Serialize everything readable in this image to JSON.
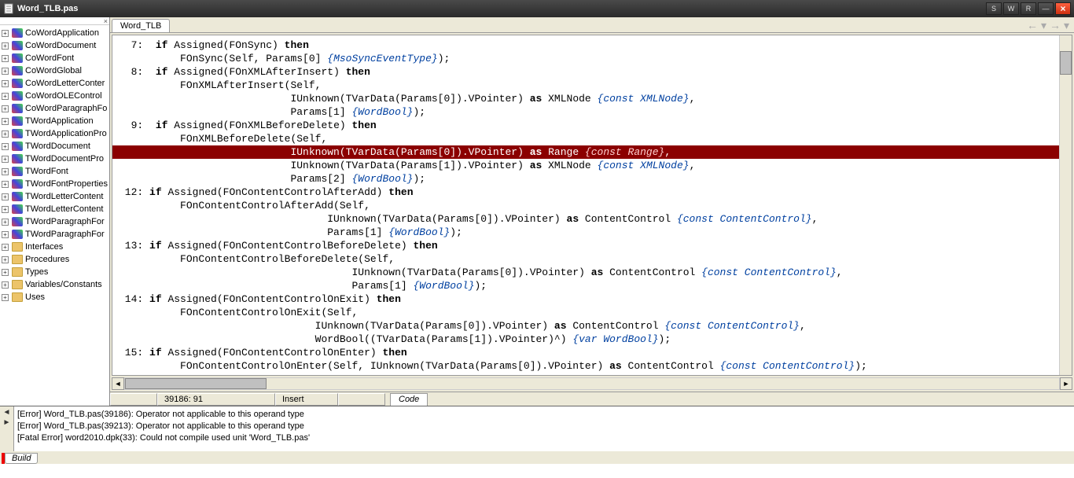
{
  "title": "Word_TLB.pas",
  "win_buttons": {
    "s": "S",
    "w": "W",
    "r": "R",
    "min": "—",
    "close": "×"
  },
  "tree": {
    "class_items": [
      "CoWordApplication",
      "CoWordDocument",
      "CoWordFont",
      "CoWordGlobal",
      "CoWordLetterConter",
      "CoWordOLEControl",
      "CoWordParagraphFo",
      "TWordApplication",
      "TWordApplicationPro",
      "TWordDocument",
      "TWordDocumentPro",
      "TWordFont",
      "TWordFontProperties",
      "TWordLetterContent",
      "TWordLetterContent",
      "TWordParagraphFor",
      "TWordParagraphFor"
    ],
    "folder_items": [
      "Interfaces",
      "Procedures",
      "Types",
      "Variables/Constants",
      "Uses"
    ]
  },
  "editor": {
    "open_tab": "Word_TLB",
    "lines": [
      {
        "n": "7:",
        "code": [
          "  ",
          [
            "kw",
            "if"
          ],
          " Assigned(FOnSync) ",
          [
            "kw",
            "then"
          ]
        ]
      },
      {
        "n": "",
        "code": [
          "      FOnSync(Self, Params[0] ",
          [
            "cmt",
            "{MsoSyncEventType}"
          ],
          ");"
        ]
      },
      {
        "n": "8:",
        "code": [
          "  ",
          [
            "kw",
            "if"
          ],
          " Assigned(FOnXMLAfterInsert) ",
          [
            "kw",
            "then"
          ]
        ]
      },
      {
        "n": "",
        "code": [
          "      FOnXMLAfterInsert(Self,"
        ]
      },
      {
        "n": "",
        "code": [
          "                        IUnknown(TVarData(Params[0]).VPointer) ",
          [
            "kw",
            "as"
          ],
          " XMLNode ",
          [
            "cmt",
            "{const XMLNode}"
          ],
          ","
        ]
      },
      {
        "n": "",
        "code": [
          "                        Params[1] ",
          [
            "cmt",
            "{WordBool}"
          ],
          ");"
        ]
      },
      {
        "n": "9:",
        "code": [
          "  ",
          [
            "kw",
            "if"
          ],
          " Assigned(FOnXMLBeforeDelete) ",
          [
            "kw",
            "then"
          ]
        ]
      },
      {
        "n": "",
        "code": [
          "      FOnXMLBeforeDelete(Self,"
        ]
      },
      {
        "n": "",
        "hl": true,
        "code": [
          "                        IUnknown(TVarData(Params[0]).VPointer) ",
          [
            "kw",
            "as"
          ],
          " Range ",
          [
            "cmt",
            "{const Range}"
          ],
          ","
        ]
      },
      {
        "n": "",
        "code": [
          "                        IUnknown(TVarData(Params[1]).VPointer) ",
          [
            "kw",
            "as"
          ],
          " XMLNode ",
          [
            "cmt",
            "{const XMLNode}"
          ],
          ","
        ]
      },
      {
        "n": "",
        "code": [
          "                        Params[2] ",
          [
            "cmt",
            "{WordBool}"
          ],
          ");"
        ]
      },
      {
        "n": "12:",
        "code": [
          " ",
          [
            "kw",
            "if"
          ],
          " Assigned(FOnContentControlAfterAdd) ",
          [
            "kw",
            "then"
          ]
        ]
      },
      {
        "n": "",
        "code": [
          "      FOnContentControlAfterAdd(Self,"
        ]
      },
      {
        "n": "",
        "code": [
          "                              IUnknown(TVarData(Params[0]).VPointer) ",
          [
            "kw",
            "as"
          ],
          " ContentControl ",
          [
            "cmt",
            "{const ContentControl}"
          ],
          ","
        ]
      },
      {
        "n": "",
        "code": [
          "                              Params[1] ",
          [
            "cmt",
            "{WordBool}"
          ],
          ");"
        ]
      },
      {
        "n": "13:",
        "code": [
          " ",
          [
            "kw",
            "if"
          ],
          " Assigned(FOnContentControlBeforeDelete) ",
          [
            "kw",
            "then"
          ]
        ]
      },
      {
        "n": "",
        "code": [
          "      FOnContentControlBeforeDelete(Self,"
        ]
      },
      {
        "n": "",
        "code": [
          "                                  IUnknown(TVarData(Params[0]).VPointer) ",
          [
            "kw",
            "as"
          ],
          " ContentControl ",
          [
            "cmt",
            "{const ContentControl}"
          ],
          ","
        ]
      },
      {
        "n": "",
        "code": [
          "                                  Params[1] ",
          [
            "cmt",
            "{WordBool}"
          ],
          ");"
        ]
      },
      {
        "n": "14:",
        "code": [
          " ",
          [
            "kw",
            "if"
          ],
          " Assigned(FOnContentControlOnExit) ",
          [
            "kw",
            "then"
          ]
        ]
      },
      {
        "n": "",
        "code": [
          "      FOnContentControlOnExit(Self,"
        ]
      },
      {
        "n": "",
        "code": [
          "                            IUnknown(TVarData(Params[0]).VPointer) ",
          [
            "kw",
            "as"
          ],
          " ContentControl ",
          [
            "cmt",
            "{const ContentControl}"
          ],
          ","
        ]
      },
      {
        "n": "",
        "code": [
          "                            WordBool((TVarData(Params[1]).VPointer)^) ",
          [
            "cmt",
            "{var WordBool}"
          ],
          ");"
        ]
      },
      {
        "n": "15:",
        "code": [
          " ",
          [
            "kw",
            "if"
          ],
          " Assigned(FOnContentControlOnEnter) ",
          [
            "kw",
            "then"
          ]
        ]
      },
      {
        "n": "",
        "code": [
          "      FOnContentControlOnEnter(Self, IUnknown(TVarData(Params[0]).VPointer) ",
          [
            "kw",
            "as"
          ],
          " ContentControl ",
          [
            "cmt",
            "{const ContentControl}"
          ],
          ");"
        ]
      }
    ]
  },
  "status": {
    "pos": "39186: 91",
    "mode": "Insert",
    "view_tab": "Code"
  },
  "messages": [
    "[Error] Word_TLB.pas(39186): Operator not applicable to this operand type",
    "[Error] Word_TLB.pas(39213): Operator not applicable to this operand type",
    "[Fatal Error] word2010.dpk(33): Could not compile used unit 'Word_TLB.pas'"
  ],
  "bottom_tab": "Build"
}
